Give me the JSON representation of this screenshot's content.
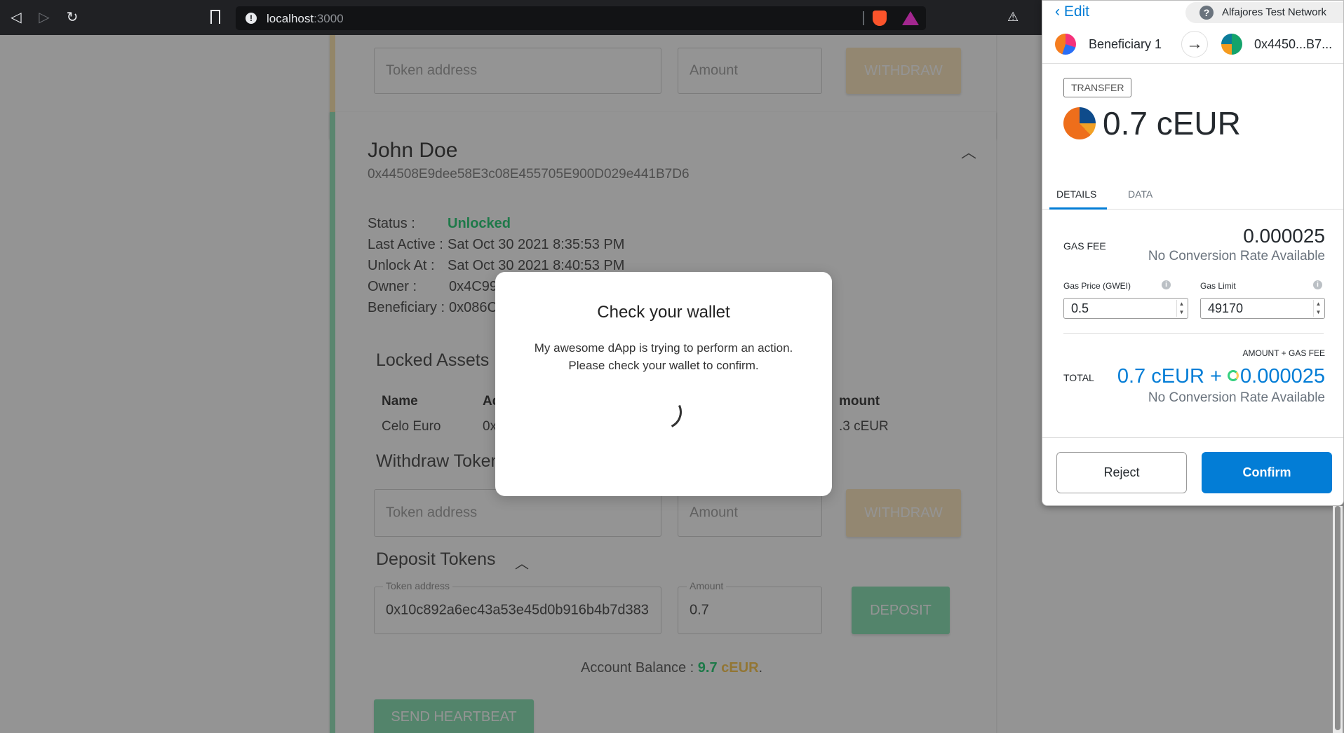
{
  "browser": {
    "url_host": "localhost",
    "url_port": ":3000"
  },
  "page": {
    "top_card": {
      "token_address_placeholder": "Token address",
      "amount_placeholder": "Amount",
      "withdraw_label": "WITHDRAW"
    },
    "beneficiary": {
      "name": "John Doe",
      "address": "0x44508E9dee58E3c08E455705E900D029e441B7D6",
      "status_label": "Status :",
      "status_value": "Unlocked",
      "last_active_label": "Last Active :",
      "last_active_value": "Sat Oct 30 2021 8:35:53 PM",
      "unlock_at_label": "Unlock At :",
      "unlock_at_value": "Sat Oct 30 2021 8:40:53 PM",
      "owner_label": "Owner :",
      "owner_value": "0x4C99",
      "beneficiary_label": "Beneficiary :",
      "beneficiary_value": "0x086C"
    },
    "locked_assets": {
      "title": "Locked Assets",
      "col_name": "Name",
      "col_address": "Ad",
      "col_amount": "mount",
      "row_name": "Celo Euro",
      "row_address": "0x1",
      "row_amount": ".3 cEUR"
    },
    "withdraw_tokens": {
      "title": "Withdraw Token",
      "token_address_placeholder": "Token address",
      "amount_placeholder": "Amount",
      "withdraw_label": "WITHDRAW"
    },
    "deposit_tokens": {
      "title": "Deposit Tokens",
      "token_address_label": "Token address",
      "token_address_value": "0x10c892a6ec43a53e45d0b916b4b7d383",
      "amount_label": "Amount",
      "amount_value": "0.7",
      "deposit_label": "DEPOSIT"
    },
    "account_balance": {
      "label": "Account Balance :",
      "value": "9.7",
      "unit": "cEUR",
      "suffix": "."
    },
    "heartbeat_label": "SEND HEARTBEAT"
  },
  "modal": {
    "title": "Check your wallet",
    "line1": "My awesome dApp is trying to perform an action.",
    "line2": "Please check your wallet to confirm."
  },
  "wallet": {
    "edit_label": "Edit",
    "network": "Alfajores Test Network",
    "from_name": "Beneficiary 1",
    "to_name": "0x4450...B7...",
    "badge": "TRANSFER",
    "amount": "0.7 cEUR",
    "tabs": {
      "details": "DETAILS",
      "data": "DATA"
    },
    "gas_fee_label": "GAS FEE",
    "gas_fee_value": "0.000025",
    "no_conversion": "No Conversion Rate Available",
    "gas_price_label": "Gas Price (GWEI)",
    "gas_price_value": "0.5",
    "gas_limit_label": "Gas Limit",
    "gas_limit_value": "49170",
    "amount_gas_label": "AMOUNT + GAS FEE",
    "total_label": "TOTAL",
    "total_amount": "0.7 cEUR +",
    "total_fee": "0.000025",
    "total_conversion": "No Conversion Rate Available",
    "reject_label": "Reject",
    "confirm_label": "Confirm"
  },
  "colors": {
    "accent": "#037dd6",
    "unlocked": "#35d07f",
    "ceur": "#fbcc5c"
  }
}
